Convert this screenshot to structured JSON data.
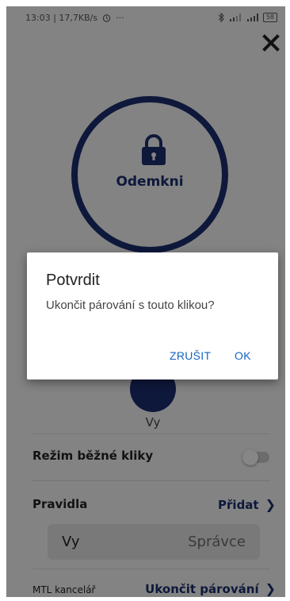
{
  "status_bar": {
    "time_info": "13:03 | 17,7KB/s",
    "more": "···",
    "battery": "58"
  },
  "lock_button": {
    "label": "Odemkni"
  },
  "user": {
    "name": "Vy"
  },
  "settings": {
    "normal_mode_label": "Režim běžné kliky",
    "normal_mode_on": false,
    "rules_label": "Pravidla",
    "add_label": "Přidat",
    "rule": {
      "user": "Vy",
      "role": "Správce"
    },
    "office_name": "MTL kancelář",
    "unpair_label": "Ukončit párování"
  },
  "dialog": {
    "title": "Potvrdit",
    "message": "Ukončit párování s touto klikou?",
    "cancel": "ZRUŠIT",
    "ok": "OK"
  },
  "colors": {
    "brand": "#1b2d6e",
    "dialog_button": "#1565c0"
  }
}
